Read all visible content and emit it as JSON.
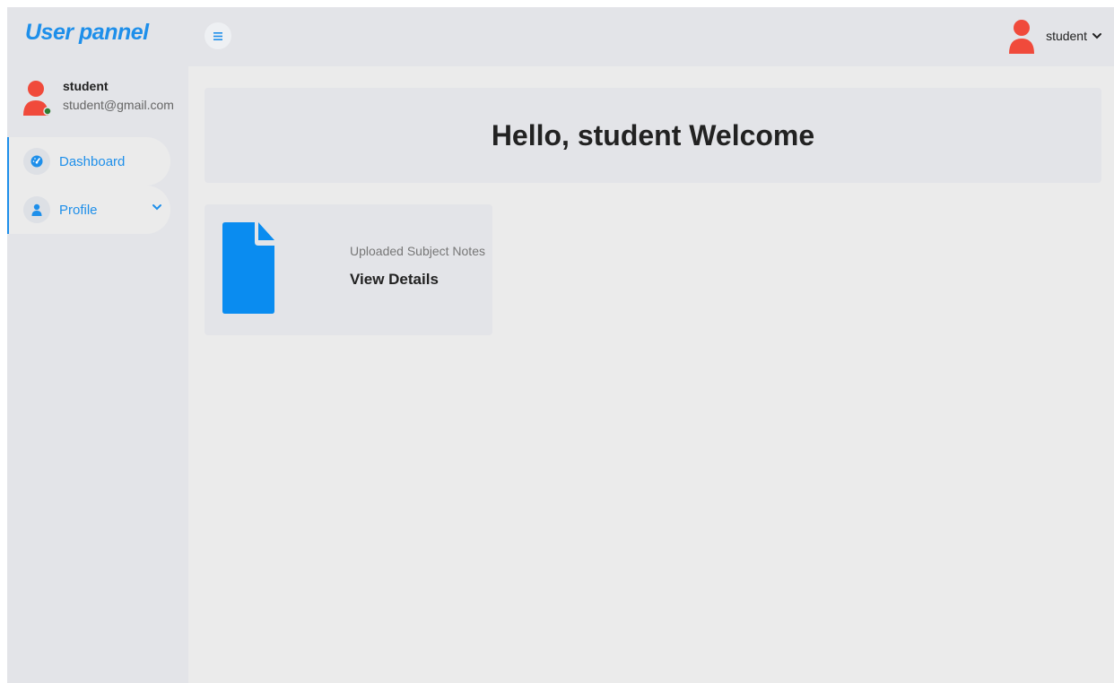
{
  "brand": {
    "title": "User pannel"
  },
  "user": {
    "name": "student",
    "email": "student@gmail.com"
  },
  "nav": {
    "items": [
      {
        "label": "Dashboard",
        "icon": "gauge-icon"
      },
      {
        "label": "Profile",
        "icon": "user-icon"
      }
    ]
  },
  "header": {
    "username": "student"
  },
  "welcome": {
    "heading": "Hello, student Welcome"
  },
  "card": {
    "label": "Uploaded Subject Notes",
    "link": "View Details",
    "icon": "document-icon"
  },
  "colors": {
    "accent": "#1e8fea",
    "doc_blue": "#0a8cf0",
    "avatar_red": "#f04a3b",
    "online_green": "#2e7d32"
  }
}
